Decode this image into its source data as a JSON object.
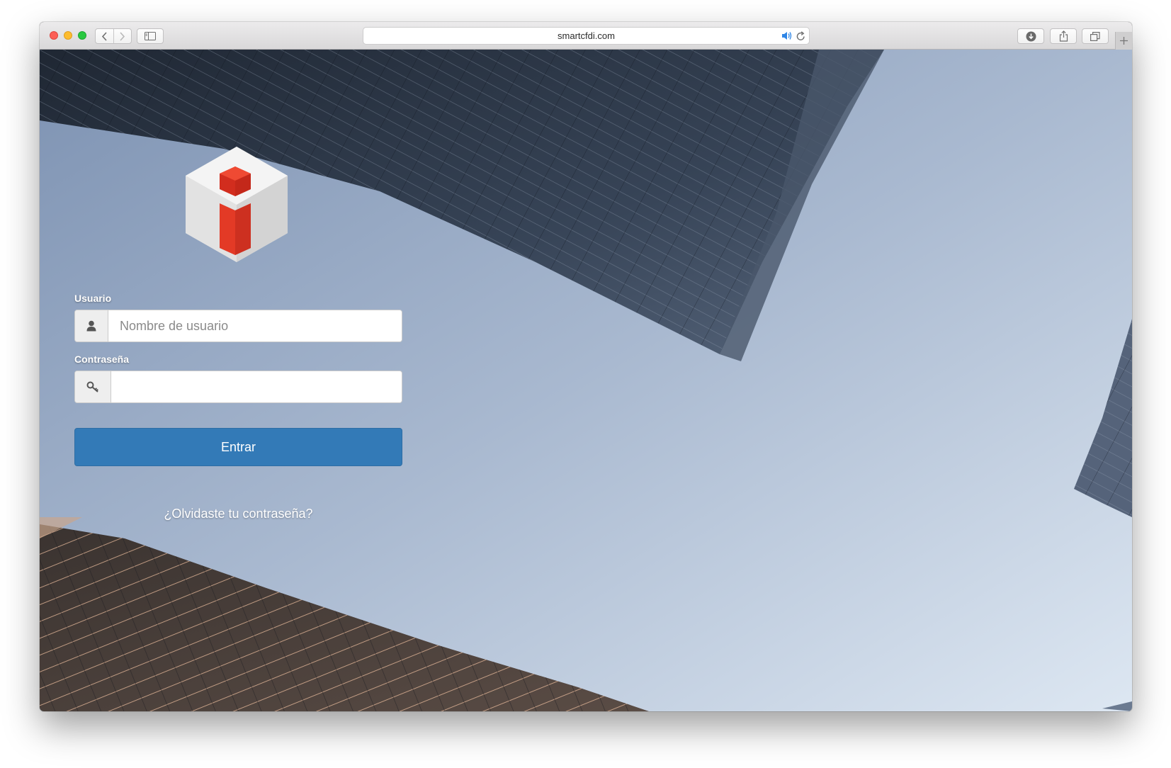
{
  "browser": {
    "url": "smartcfdi.com",
    "icons": {
      "back": "chevron-left-icon",
      "forward": "chevron-right-icon",
      "sidebar": "sidebar-icon",
      "audio": "speaker-icon",
      "reload": "reload-icon",
      "download": "download-icon",
      "share": "share-icon",
      "tabs": "tabs-overview-icon",
      "new_tab": "plus-icon"
    }
  },
  "login": {
    "logo_icon": "info-cube-logo",
    "username_label": "Usuario",
    "username_placeholder": "Nombre de usuario",
    "username_value": "",
    "username_icon": "user-icon",
    "password_label": "Contraseña",
    "password_value": "",
    "password_icon": "key-icon",
    "submit_label": "Entrar",
    "forgot_link": "¿Olvidaste tu contraseña?"
  },
  "colors": {
    "primary_button": "#337ab7",
    "logo_red": "#e33a26",
    "sky": "#a3b3cc"
  }
}
